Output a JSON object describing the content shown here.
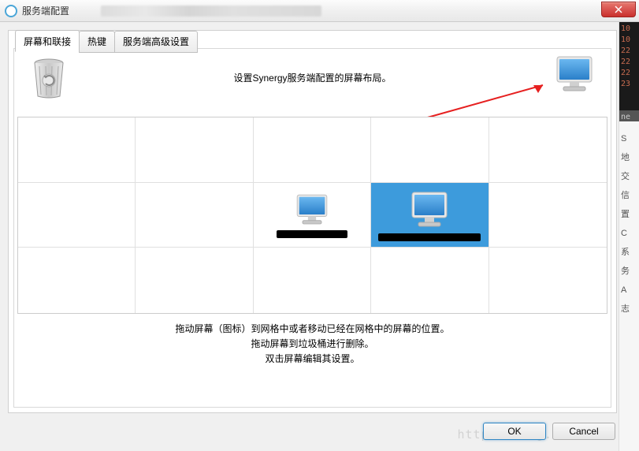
{
  "window": {
    "title": "服务端配置"
  },
  "tabs": {
    "screens": "屏幕和联接",
    "hotkeys": "热键",
    "advanced": "服务端高级设置"
  },
  "instructions": {
    "top": "设置Synergy服务端配置的屏幕布局。",
    "line1": "拖动屏幕（图标）到网格中或者移动已经在网格中的屏幕的位置。",
    "line2": "拖动屏幕到垃圾桶进行删除。",
    "line3": "双击屏幕编辑其设置。"
  },
  "buttons": {
    "ok": "OK",
    "cancel": "Cancel"
  },
  "rightstrip": {
    "dark_lines": [
      "10",
      "10",
      "22",
      "22",
      "22",
      "23"
    ],
    "light_items": [
      "S",
      "地",
      "交",
      "信",
      "置",
      "C",
      "系",
      "务",
      "A",
      "志"
    ]
  },
  "watermark": "http://blog.csdn"
}
